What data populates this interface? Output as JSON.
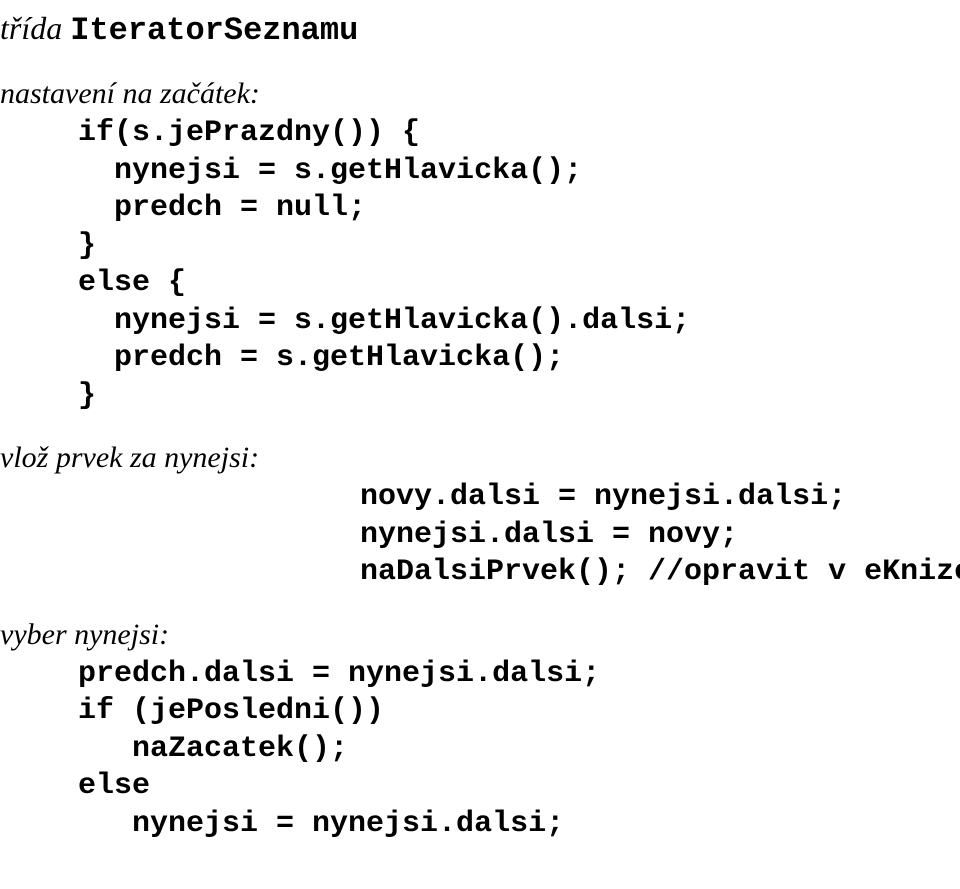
{
  "title": {
    "italic": "třída ",
    "mono": "IteratorSeznamu"
  },
  "sec1": {
    "label": "nastavení na začátek:",
    "code": "if(s.jePrazdny()) {\n  nynejsi = s.getHlavicka();\n  predch = null;\n}\nelse {\n  nynejsi = s.getHlavicka().dalsi;\n  predch = s.getHlavicka();\n}"
  },
  "sec2": {
    "label": "vlož prvek za nynejsi:",
    "code": "novy.dalsi = nynejsi.dalsi;\nnynejsi.dalsi = novy;\nnaDalsiPrvek(); //opravit v eKnize"
  },
  "sec3": {
    "label": "vyber nynejsi:",
    "code": "predch.dalsi = nynejsi.dalsi;\nif (jePosledni())\n   naZacatek();\nelse\n   nynejsi = nynejsi.dalsi;"
  }
}
